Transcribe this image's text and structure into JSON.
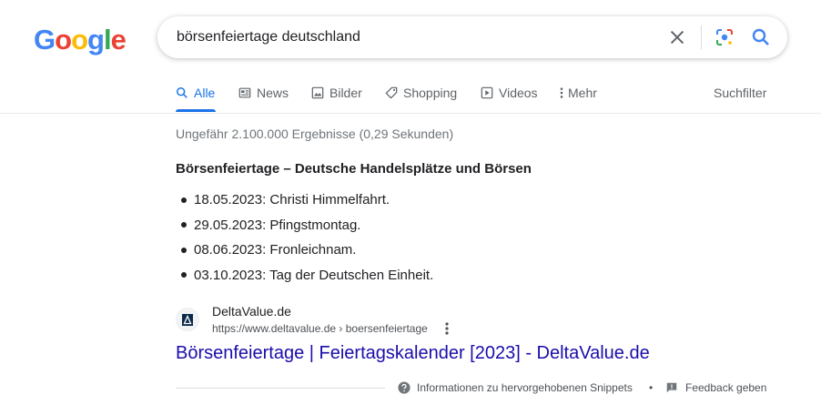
{
  "logo": {
    "letters": [
      "G",
      "o",
      "o",
      "g",
      "l",
      "e"
    ],
    "colors": [
      "#4285F4",
      "#EA4335",
      "#FBBC05",
      "#4285F4",
      "#34A853",
      "#EA4335"
    ]
  },
  "search": {
    "query": "börsenfeiertage deutschland",
    "icons": [
      "close-icon",
      "lens-icon",
      "search-icon"
    ]
  },
  "tabs": [
    {
      "label": "Alle",
      "icon": "search-icon",
      "active": true
    },
    {
      "label": "News",
      "icon": "news-icon"
    },
    {
      "label": "Bilder",
      "icon": "image-icon"
    },
    {
      "label": "Shopping",
      "icon": "tag-icon"
    },
    {
      "label": "Videos",
      "icon": "play-icon"
    },
    {
      "label": "Mehr",
      "icon": "more-vert-icon"
    }
  ],
  "tools": {
    "label": "Suchfilter"
  },
  "stats": "Ungefähr 2.100.000 Ergebnisse (0,29 Sekunden)",
  "snippet": {
    "title": "Börsenfeiertage – Deutsche Handelsplätze und Börsen",
    "items": [
      "18.05.2023: Christi Himmelfahrt.",
      "29.05.2023: Pfingstmontag.",
      "08.06.2023: Fronleichnam.",
      "03.10.2023: Tag der Deutschen Einheit."
    ]
  },
  "result": {
    "site_name": "DeltaValue.de",
    "url": "https://www.deltavalue.de › boersenfeiertage",
    "title": "Börsenfeiertage | Feiertagskalender [2023] - DeltaValue.de"
  },
  "footer": {
    "info": "Informationen zu hervorgehobenen Snippets",
    "bullet": "•",
    "feedback": "Feedback geben"
  }
}
